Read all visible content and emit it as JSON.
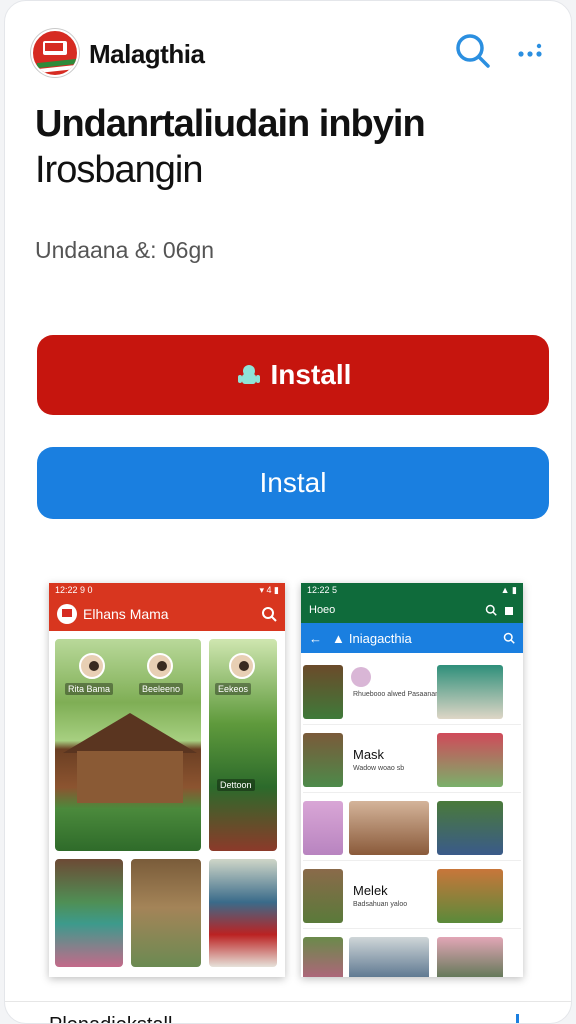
{
  "header": {
    "brand": "Malagthia",
    "search_icon": "search-icon",
    "more_icon": "more-dots-icon"
  },
  "app": {
    "title_line1": "Undanrtaliudain inbyin",
    "title_line2": "Irosbangin",
    "meta": "Undaana &: 06gn"
  },
  "buttons": {
    "install_primary": "Install",
    "install_secondary": "Instal"
  },
  "screenshots": {
    "phone1": {
      "status_time": "12:22 9 0",
      "status_right": "▾ 4 ▮",
      "title": "Elhans Mama",
      "labels": [
        "Rita Bama",
        "Beeleeno",
        "Eekeos",
        "Dettoon"
      ]
    },
    "phone2": {
      "status_time": "12:22 5",
      "status_right": "▲ ▮",
      "bar1_title": "Hoeo",
      "bar2_title": "Iniagacthia",
      "rows": [
        {
          "label": "",
          "sub": "Rhuebooo alwed\nPasaanam nnhahed"
        },
        {
          "label": "Mask",
          "sub": "Wadow woao sb"
        },
        {
          "label": "",
          "sub": ""
        },
        {
          "label": "Melek",
          "sub": "Badsahuan yaloo"
        },
        {
          "label": "",
          "sub": ""
        }
      ]
    }
  },
  "footer": {
    "text": "Plenadiekstall"
  },
  "colors": {
    "install_red": "#c6150e",
    "install_blue": "#1a7fe0",
    "phone1_bar": "#d8361f",
    "phone2_bar": "#0f6b3b"
  }
}
